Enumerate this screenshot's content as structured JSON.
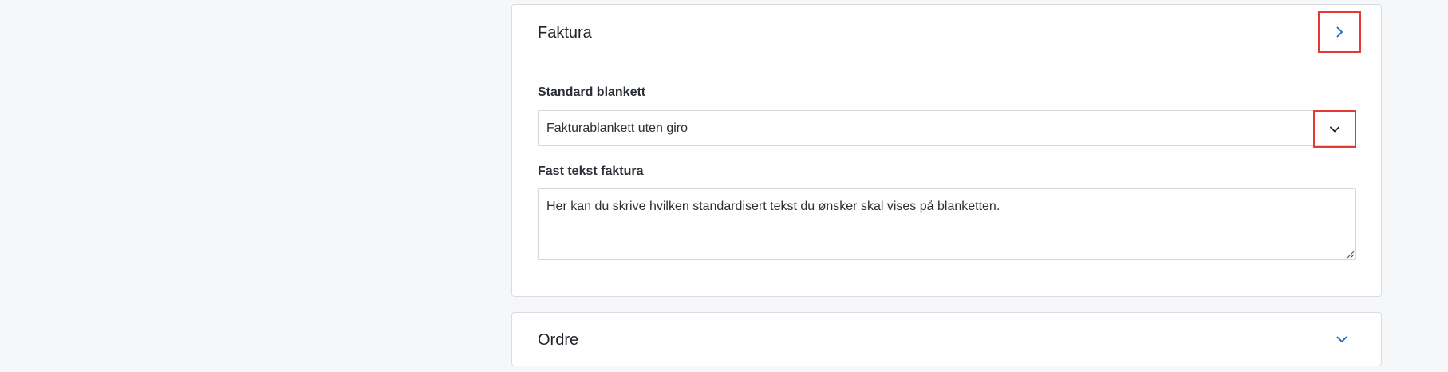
{
  "faktura_panel": {
    "title": "Faktura",
    "toggle_icon": "chevron-right-icon",
    "standard_blankett": {
      "label": "Standard blankett",
      "selected_value": "Fakturablankett uten giro",
      "arrow_icon": "chevron-down-icon"
    },
    "fast_tekst": {
      "label": "Fast tekst faktura",
      "value": "Her kan du skrive hvilken standardisert tekst du ønsker skal vises på blanketten."
    }
  },
  "ordre_panel": {
    "title": "Ordre",
    "toggle_icon": "chevron-down-icon"
  },
  "colors": {
    "accent_blue": "#1565c0",
    "highlight_red": "#e53935",
    "page_background": "#f6f7f9"
  }
}
